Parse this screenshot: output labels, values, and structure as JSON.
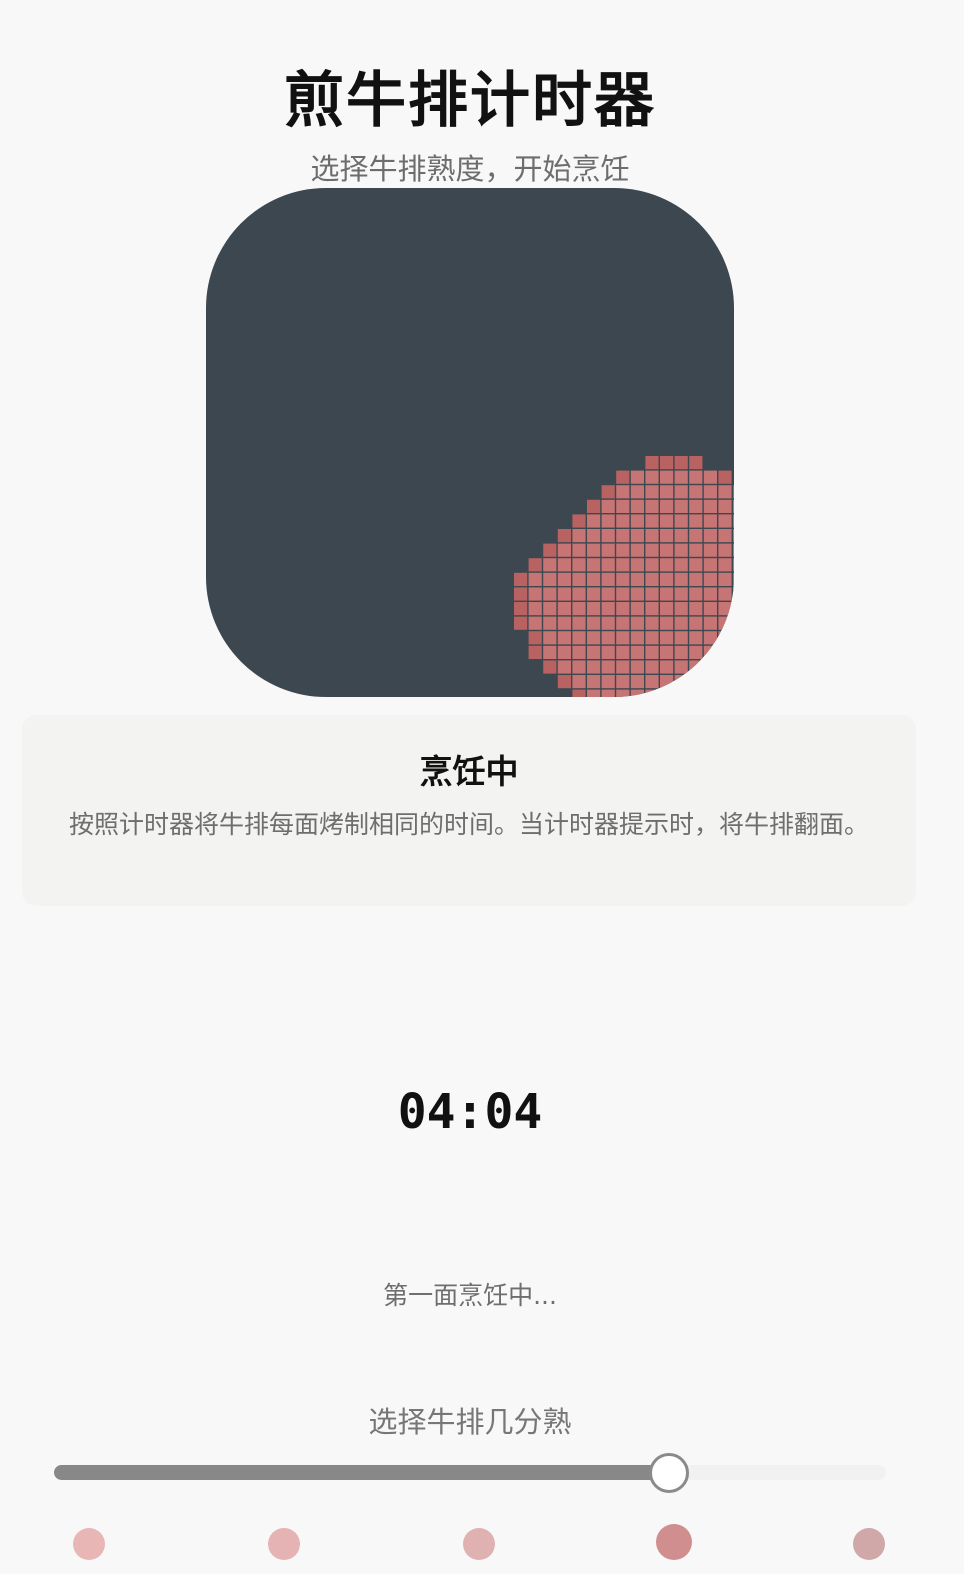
{
  "header": {
    "title": "煎牛排计时器",
    "subtitle": "选择牛排熟度，开始烹饪"
  },
  "steak_icon": {
    "tile_color": "#3c4750",
    "meat_color": "#c77474",
    "meat_edge_color": "#b86262",
    "grid_color": "#8f5558"
  },
  "info_card": {
    "title": "烹饪中",
    "description": "按照计时器将牛排每面烤制相同的时间。当计时器提示时，将牛排翻面。"
  },
  "timer": {
    "display": "04:04"
  },
  "status": {
    "text": "第一面烹饪中..."
  },
  "doneness_slider": {
    "label": "选择牛排几分熟",
    "value_fraction": 0.738,
    "track_color": "#f1f1f1",
    "fill_color": "#888888",
    "stop_count": 5,
    "selected_stop": 3,
    "stop_colors": [
      "#e9b6b6",
      "#e5b3b3",
      "#e0b1b1",
      "#d18e8e",
      "#d1a8a8"
    ]
  }
}
